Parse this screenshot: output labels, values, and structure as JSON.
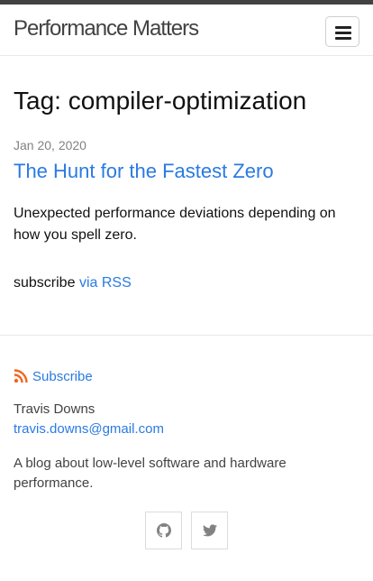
{
  "header": {
    "site_title": "Performance Matters",
    "menu_icon": "hamburger-icon"
  },
  "main": {
    "heading": "Tag: compiler-optimization",
    "posts": [
      {
        "date": "Jan 20, 2020",
        "title": "The Hunt for the Fastest Zero",
        "excerpt": "Unexpected performance deviations depending on how you spell zero."
      }
    ],
    "rss": {
      "prefix": "subscribe",
      "link": "via RSS"
    }
  },
  "footer": {
    "subscribe_label": "Subscribe",
    "subscribe_icon": "rss-icon",
    "author": "Travis Downs",
    "email": "travis.downs@gmail.com",
    "description": "A blog about low-level software and hardware performance.",
    "social": [
      {
        "name": "github",
        "icon": "github-icon"
      },
      {
        "name": "twitter",
        "icon": "twitter-icon"
      }
    ]
  },
  "colors": {
    "link": "#2a7ae2",
    "text": "#111111",
    "muted": "#828282",
    "top_bar": "#424242",
    "rss_orange": "#f26522"
  }
}
